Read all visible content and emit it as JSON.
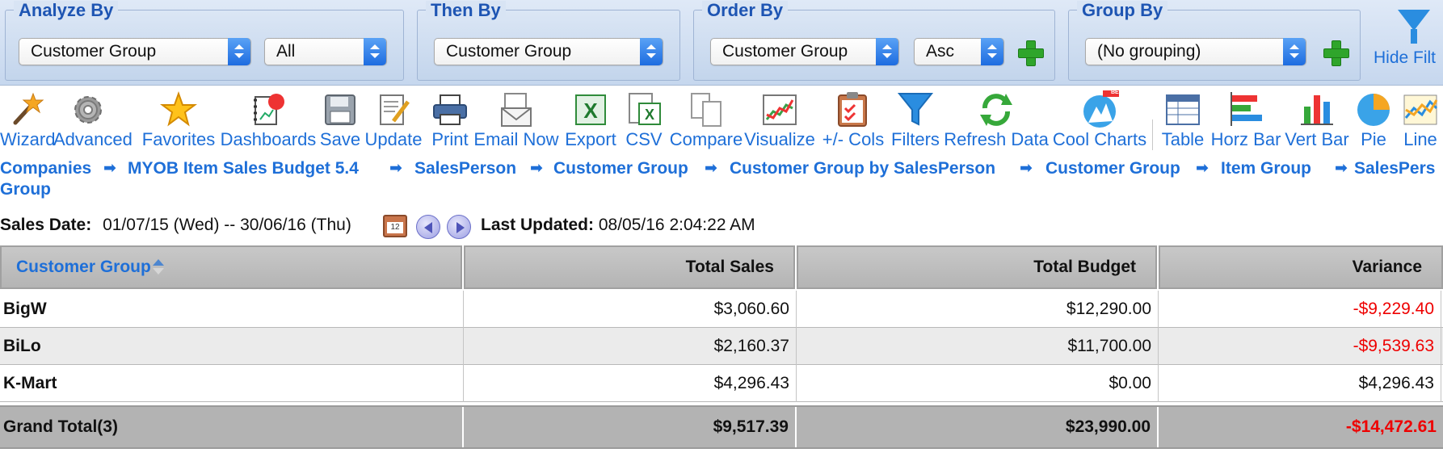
{
  "filters": {
    "analyze_by": {
      "legend": "Analyze By",
      "select1": "Customer Group",
      "select2": "All"
    },
    "then_by": {
      "legend": "Then By",
      "select1": "Customer Group"
    },
    "order_by": {
      "legend": "Order By",
      "select1": "Customer Group",
      "select2": "Asc"
    },
    "group_by": {
      "legend": "Group By",
      "select1": "(No grouping)"
    },
    "hide_filter_label": "Hide Filt"
  },
  "toolbar": {
    "wizard": "Wizard",
    "advanced": "Advanced",
    "favorites": "Favorites",
    "dashboards": "Dashboards",
    "save": "Save",
    "update": "Update",
    "print": "Print",
    "email_now": "Email Now",
    "export": "Export",
    "csv": "CSV",
    "compare": "Compare",
    "visualize": "Visualize",
    "cols": "+/- Cols",
    "filters": "Filters",
    "refresh_data": "Refresh Data",
    "cool_charts": "Cool Charts",
    "beta": "BETA",
    "table": "Table",
    "horz_bar": "Horz Bar",
    "vert_bar": "Vert Bar",
    "pie": "Pie",
    "line": "Line"
  },
  "breadcrumb": {
    "c1": "Companies",
    "c2": "MYOB Item Sales Budget 5.4",
    "c3": "SalesPerson",
    "c4": "Customer Group",
    "c5": "Customer Group by SalesPerson",
    "c6": "Customer Group",
    "c7": "Item Group",
    "c8": "SalesPers",
    "c9": "Group"
  },
  "dateline": {
    "sales_date_label": "Sales Date:",
    "sales_date_value": "01/07/15 (Wed) -- 30/06/16 (Thu)",
    "calendar_day": "12",
    "last_updated_label": "Last Updated:",
    "last_updated_value": "08/05/16 2:04:22 AM"
  },
  "table": {
    "headers": {
      "group": "Customer Group",
      "total_sales": "Total Sales",
      "total_budget": "Total Budget",
      "variance": "Variance"
    },
    "rows": [
      {
        "name": "BigW",
        "sales": "$3,060.60",
        "budget": "$12,290.00",
        "variance": "-$9,229.40"
      },
      {
        "name": "BiLo",
        "sales": "$2,160.37",
        "budget": "$11,700.00",
        "variance": "-$9,539.63"
      },
      {
        "name": "K-Mart",
        "sales": "$4,296.43",
        "budget": "$0.00",
        "variance": "$4,296.43"
      }
    ],
    "total": {
      "name": "Grand Total(3)",
      "sales": "$9,517.39",
      "budget": "$23,990.00",
      "variance": "-$14,472.61"
    }
  },
  "colors": {
    "link": "#1e6fd8",
    "negative": "#ee0000",
    "legend": "#1e55b3"
  }
}
